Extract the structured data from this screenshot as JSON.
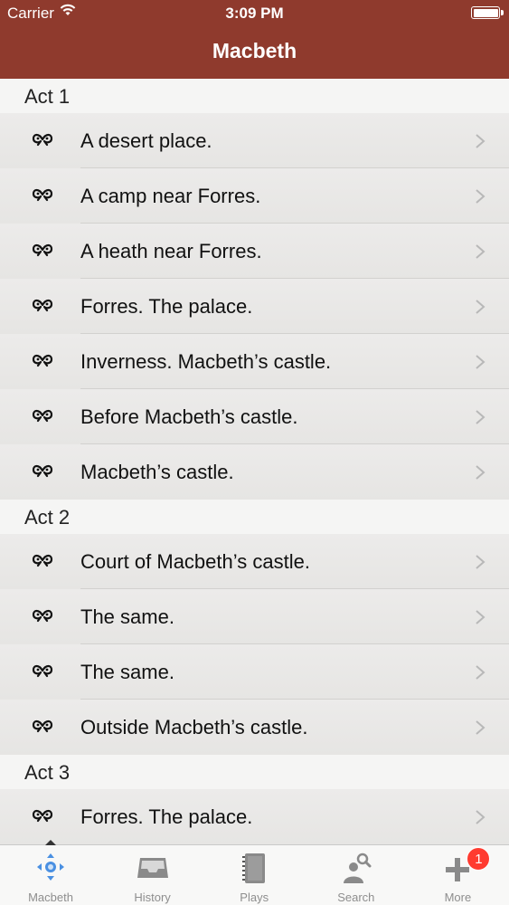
{
  "status_bar": {
    "carrier": "Carrier",
    "time": "3:09 PM"
  },
  "nav": {
    "title": "Macbeth"
  },
  "acts": [
    {
      "title": "Act 1",
      "scenes": [
        "A desert place.",
        "A camp near Forres.",
        "A heath near Forres.",
        "Forres. The palace.",
        "Inverness. Macbeth’s castle.",
        "Before Macbeth’s castle.",
        "Macbeth’s castle."
      ]
    },
    {
      "title": "Act 2",
      "scenes": [
        "Court of Macbeth’s castle.",
        "The same.",
        "The same.",
        "Outside Macbeth’s castle."
      ]
    },
    {
      "title": "Act 3",
      "scenes": [
        "Forres. The palace."
      ]
    }
  ],
  "row_icon": "scene-icon",
  "tabs": [
    {
      "label": "Macbeth",
      "icon": "play-nav-icon",
      "active": true
    },
    {
      "label": "History",
      "icon": "inbox-tray-icon",
      "active": false
    },
    {
      "label": "Plays",
      "icon": "notebook-icon",
      "active": false
    },
    {
      "label": "Search",
      "icon": "search-person-icon",
      "active": false
    },
    {
      "label": "More",
      "icon": "plus-icon",
      "active": false,
      "badge": "1"
    }
  ],
  "colors": {
    "nav_bar": "#8f3a2d",
    "badge": "#ff3b30",
    "tab_label": "#8e8e8e"
  }
}
